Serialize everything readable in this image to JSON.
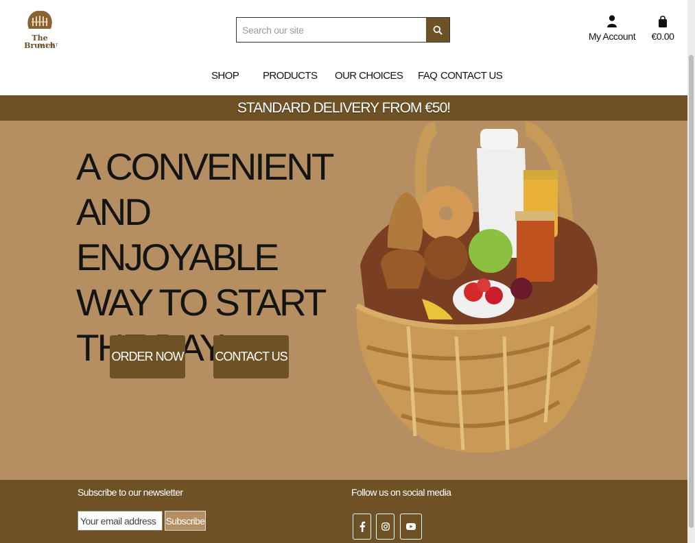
{
  "header": {
    "logo": {
      "line1": "The Brunch",
      "line2": "BASKET"
    },
    "search": {
      "placeholder": "Search our site"
    },
    "account_label": "My Account",
    "cart_total": "€0.00"
  },
  "nav": {
    "items": [
      {
        "label": "SHOP"
      },
      {
        "label": "PRODUCTS"
      },
      {
        "label": "OUR CHOICES"
      },
      {
        "label": "FAQ"
      },
      {
        "label": "CONTACT US"
      }
    ]
  },
  "banner": {
    "text": "STANDARD DELIVERY FROM €50!"
  },
  "hero": {
    "headline": "A CONVENIENT AND ENJOYABLE WAY TO START THE DAY.",
    "order_button": "ORDER NOW",
    "contact_button": "CONTACT US"
  },
  "footer": {
    "newsletter_title": "Subscribe to our newsletter",
    "email_placeholder": "Your email address",
    "subscribe_label": "Subscribe",
    "social_title": "Follow us on social media",
    "social_icons": [
      "facebook-icon",
      "instagram-icon",
      "youtube-icon"
    ]
  },
  "colors": {
    "brand_brown": "#6e5125",
    "hero_tan": "#b58f61",
    "text_dark": "#141414"
  }
}
